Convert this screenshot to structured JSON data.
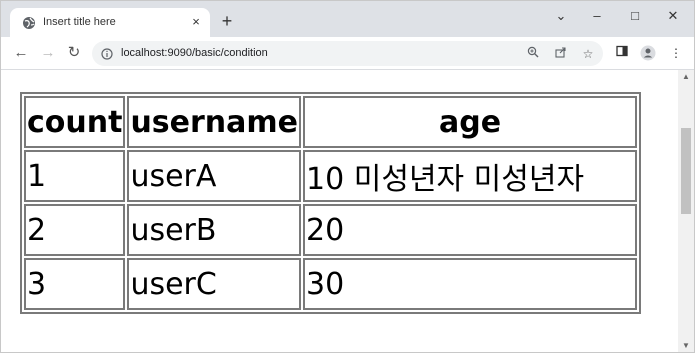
{
  "browser": {
    "tab_title": "Insert title here",
    "tab_close": "×",
    "new_tab": "+",
    "window_controls": [
      "⌄",
      "–",
      "□",
      "✕"
    ],
    "url": "localhost:9090/basic/condition",
    "icons": [
      "globe-icon",
      "back-icon",
      "forward-icon",
      "reload-icon",
      "info-icon",
      "zoom-icon",
      "share-icon",
      "star-icon",
      "sidebar-icon",
      "profile-icon",
      "menu-icon"
    ]
  },
  "table": {
    "headers": [
      "count",
      "username",
      "age"
    ],
    "rows": [
      [
        "1",
        "userA",
        "10 미성년자 미성년자"
      ],
      [
        "2",
        "userB",
        "20"
      ],
      [
        "3",
        "userC",
        "30"
      ]
    ]
  }
}
